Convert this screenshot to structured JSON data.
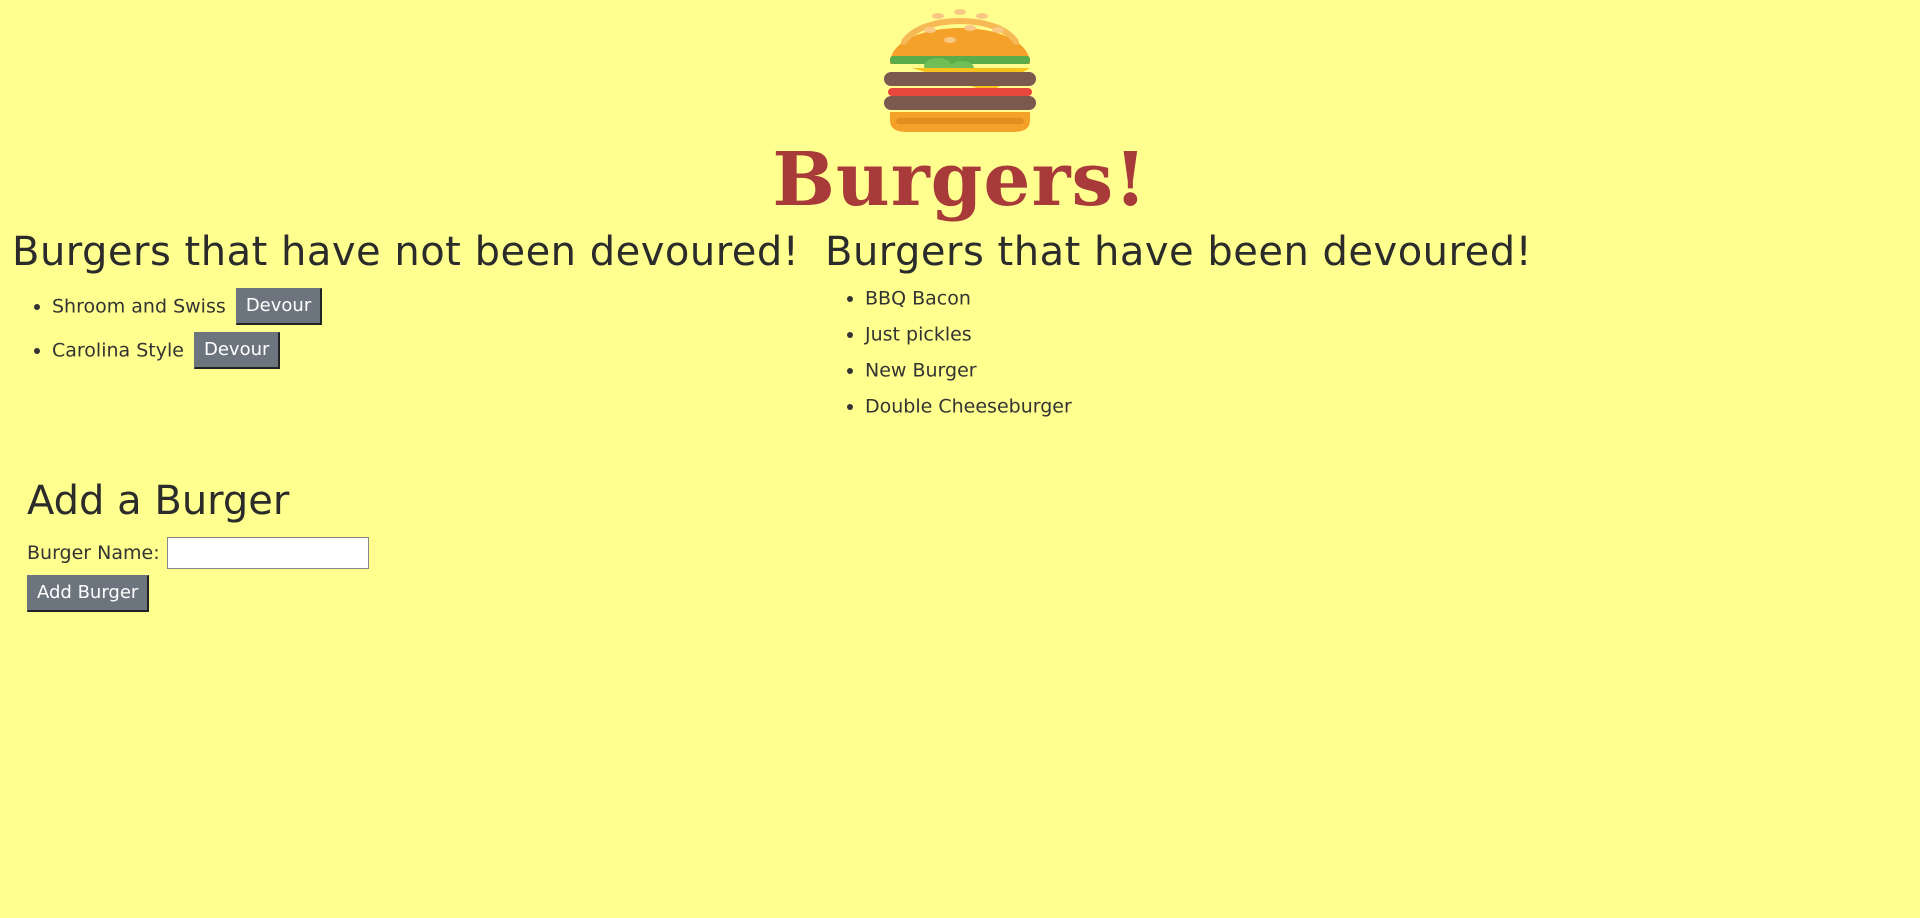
{
  "header": {
    "logo_icon": "hamburger-icon",
    "title": "Burgers!"
  },
  "not_devoured": {
    "heading": "Burgers that have not been devoured!",
    "items": [
      {
        "name": "Shroom and Swiss",
        "button_label": "Devour"
      },
      {
        "name": "Carolina Style",
        "button_label": "Devour"
      }
    ]
  },
  "devoured": {
    "heading": "Burgers that have been devoured!",
    "items": [
      {
        "name": "BBQ Bacon"
      },
      {
        "name": "Just pickles"
      },
      {
        "name": "New Burger"
      },
      {
        "name": "Double Cheeseburger"
      }
    ]
  },
  "add_form": {
    "heading": "Add a Burger",
    "label": "Burger Name:",
    "input_value": "",
    "button_label": "Add Burger"
  },
  "colors": {
    "background": "#ffff8f",
    "title": "#a83a3a",
    "button": "#6c757d"
  }
}
